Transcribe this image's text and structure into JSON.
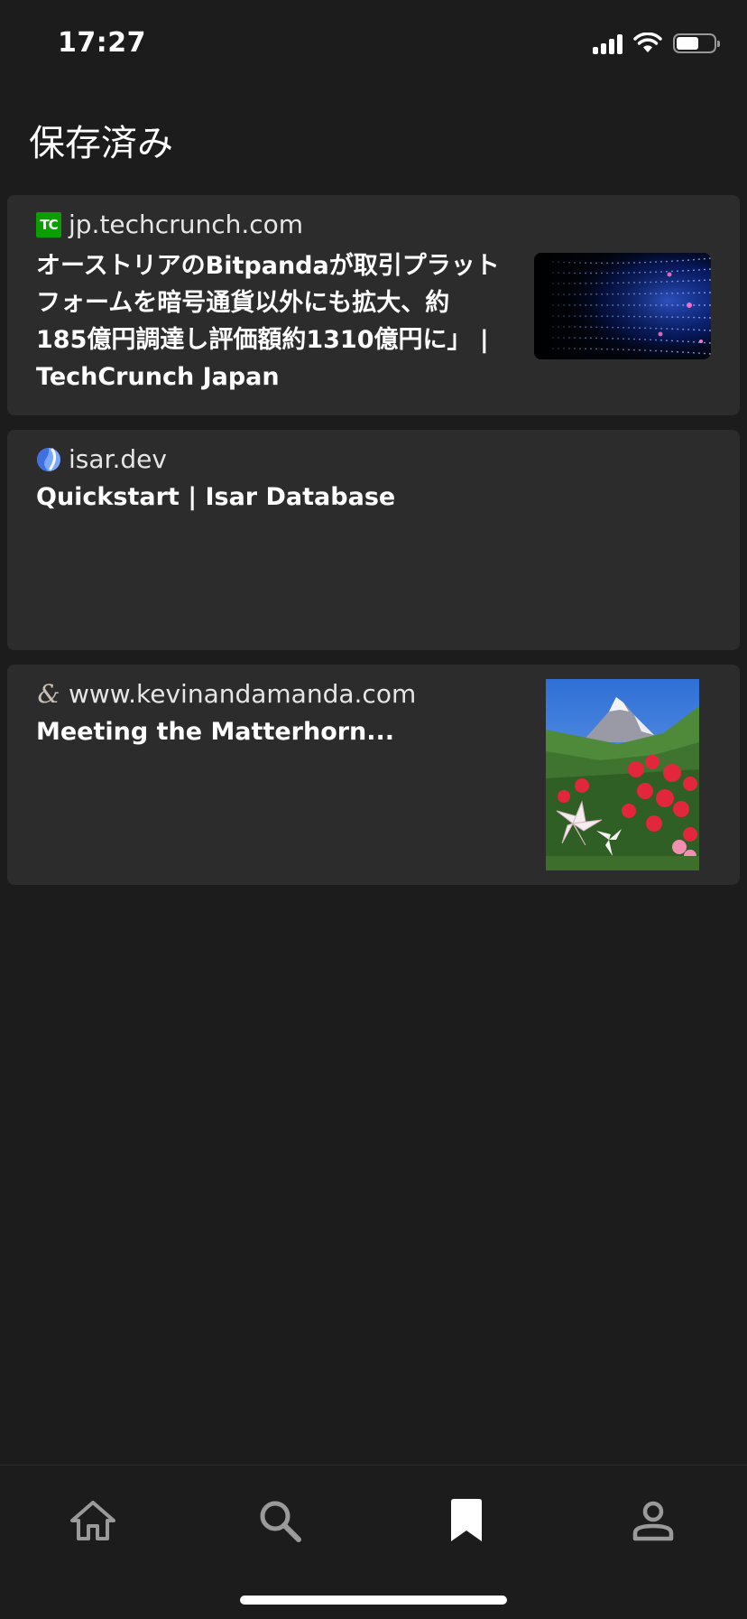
{
  "status_bar": {
    "time": "17:27",
    "battery_level": 0.6
  },
  "page": {
    "title": "保存済み"
  },
  "saved_items": [
    {
      "site": "jp.techcrunch.com",
      "favicon": "techcrunch-logo-icon",
      "favicon_text": "TC",
      "title_lines": [
        "オーストリアのBitpandaが取引プラット",
        "フォームを暗号通貨以外にも拡大、約",
        "185億円調達し評価額約1310億円に」 |",
        "TechCrunch Japan"
      ]
    },
    {
      "site": "isar.dev",
      "favicon": "isar-logo-icon",
      "title_lines": [
        "Quickstart | Isar Database"
      ]
    },
    {
      "site": "www.kevinandamanda.com",
      "favicon": "ampersand-logo-icon",
      "favicon_text": "&",
      "title_lines": [
        "Meeting the Matterhorn..."
      ]
    }
  ],
  "tab_bar": {
    "tabs": [
      {
        "icon": "home-icon",
        "active": false
      },
      {
        "icon": "search-icon",
        "active": false
      },
      {
        "icon": "bookmark-icon",
        "active": true
      },
      {
        "icon": "profile-icon",
        "active": false
      }
    ]
  },
  "colors": {
    "background": "#1c1c1c",
    "card": "#2c2c2c",
    "text": "#ffffff",
    "inactive_icon": "#9a9a9a"
  }
}
